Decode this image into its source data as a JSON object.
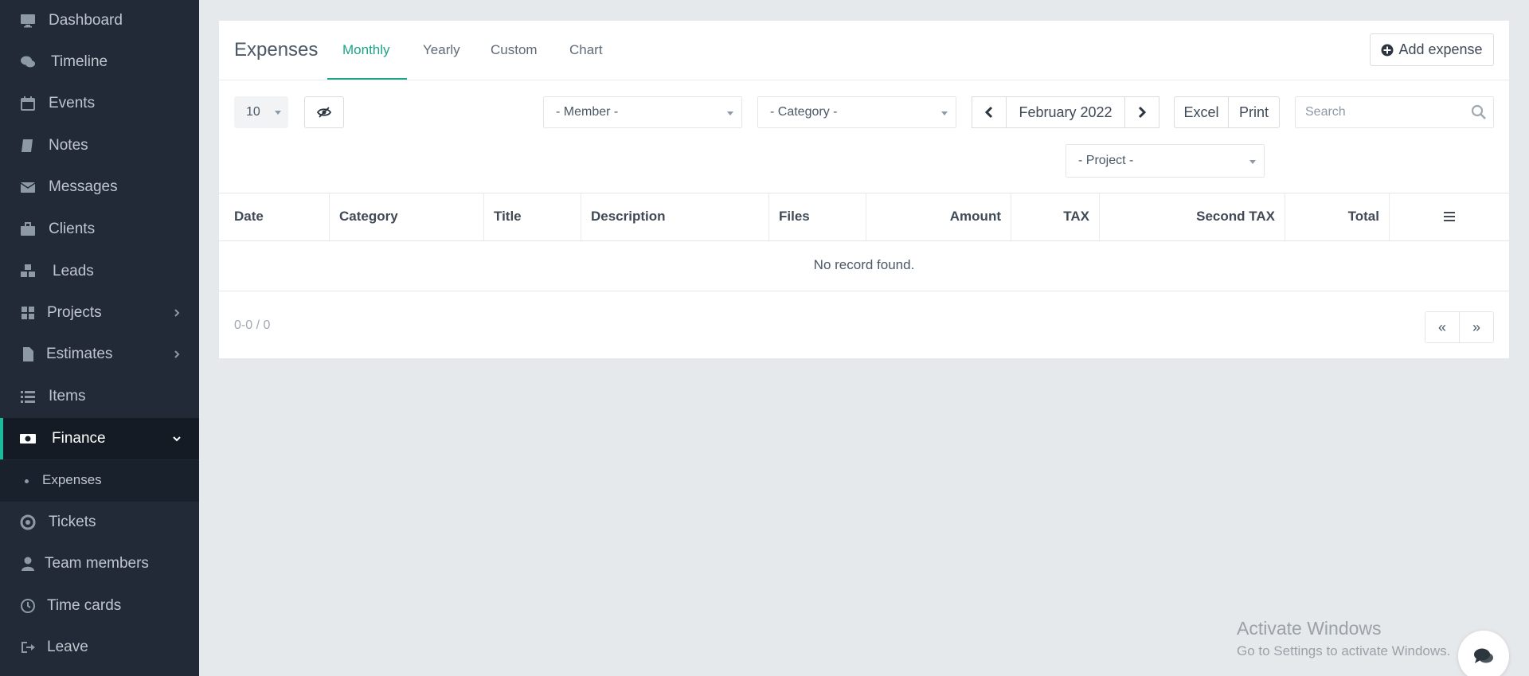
{
  "sidebar": {
    "items": [
      {
        "label": "Dashboard",
        "icon": "monitor-icon"
      },
      {
        "label": "Timeline",
        "icon": "comments-icon"
      },
      {
        "label": "Events",
        "icon": "calendar-icon"
      },
      {
        "label": "Notes",
        "icon": "book-icon"
      },
      {
        "label": "Messages",
        "icon": "envelope-icon"
      },
      {
        "label": "Clients",
        "icon": "briefcase-icon"
      },
      {
        "label": "Leads",
        "icon": "cubes-icon"
      },
      {
        "label": "Projects",
        "icon": "grid-icon"
      },
      {
        "label": "Estimates",
        "icon": "file-icon"
      },
      {
        "label": "Items",
        "icon": "list-icon"
      },
      {
        "label": "Finance",
        "icon": "money-icon"
      },
      {
        "label": "Tickets",
        "icon": "life-ring-icon"
      },
      {
        "label": "Team members",
        "icon": "user-icon"
      },
      {
        "label": "Time cards",
        "icon": "clock-icon"
      },
      {
        "label": "Leave",
        "icon": "sign-out-icon"
      }
    ],
    "submenu": {
      "label": "Expenses"
    },
    "accent": "#1bbc9b"
  },
  "header": {
    "title": "Expenses",
    "tabs": [
      {
        "label": "Monthly"
      },
      {
        "label": "Yearly"
      },
      {
        "label": "Custom"
      },
      {
        "label": "Chart"
      }
    ],
    "add_button": "Add expense"
  },
  "toolbar": {
    "page_size": "10",
    "member_select": "- Member -",
    "category_select": "- Category -",
    "project_select": "- Project -",
    "period": "February 2022",
    "excel": "Excel",
    "print": "Print",
    "search_placeholder": "Search"
  },
  "table": {
    "columns": [
      "Date",
      "Category",
      "Title",
      "Description",
      "Files",
      "Amount",
      "TAX",
      "Second TAX",
      "Total"
    ],
    "empty_message": "No record found.",
    "info": "0-0 / 0",
    "prev": "«",
    "next": "»"
  },
  "watermark": {
    "title": "Activate Windows",
    "subtitle": "Go to Settings to activate Windows."
  }
}
